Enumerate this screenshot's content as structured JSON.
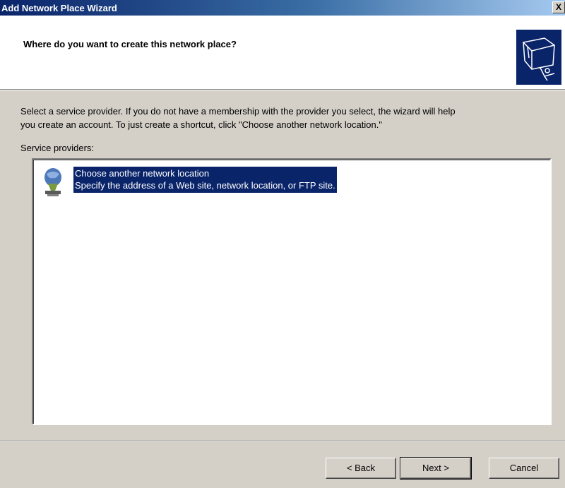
{
  "window": {
    "title": "Add Network Place Wizard",
    "close_label": "X"
  },
  "header": {
    "heading": "Where do you want to create this network place?",
    "icon": "network-folder-icon"
  },
  "body": {
    "description_line1": "Select a service provider.  If you do not have a membership with the provider you select, the wizard will help",
    "description_line2": "you create an account.  To just create a shortcut, click \"Choose another network location.\"",
    "providers_label": "Service providers:"
  },
  "providers": {
    "items": [
      {
        "title": "Choose another network location",
        "subtitle": "Specify the address of a Web site, network location, or FTP site.",
        "icon": "network-location-icon",
        "selected": true
      }
    ]
  },
  "buttons": {
    "back": "< Back",
    "next": "Next >",
    "cancel": "Cancel"
  },
  "colors": {
    "titlebar_start": "#0a246a",
    "selection": "#0a246a",
    "dialog_bg": "#d4d0c8"
  }
}
